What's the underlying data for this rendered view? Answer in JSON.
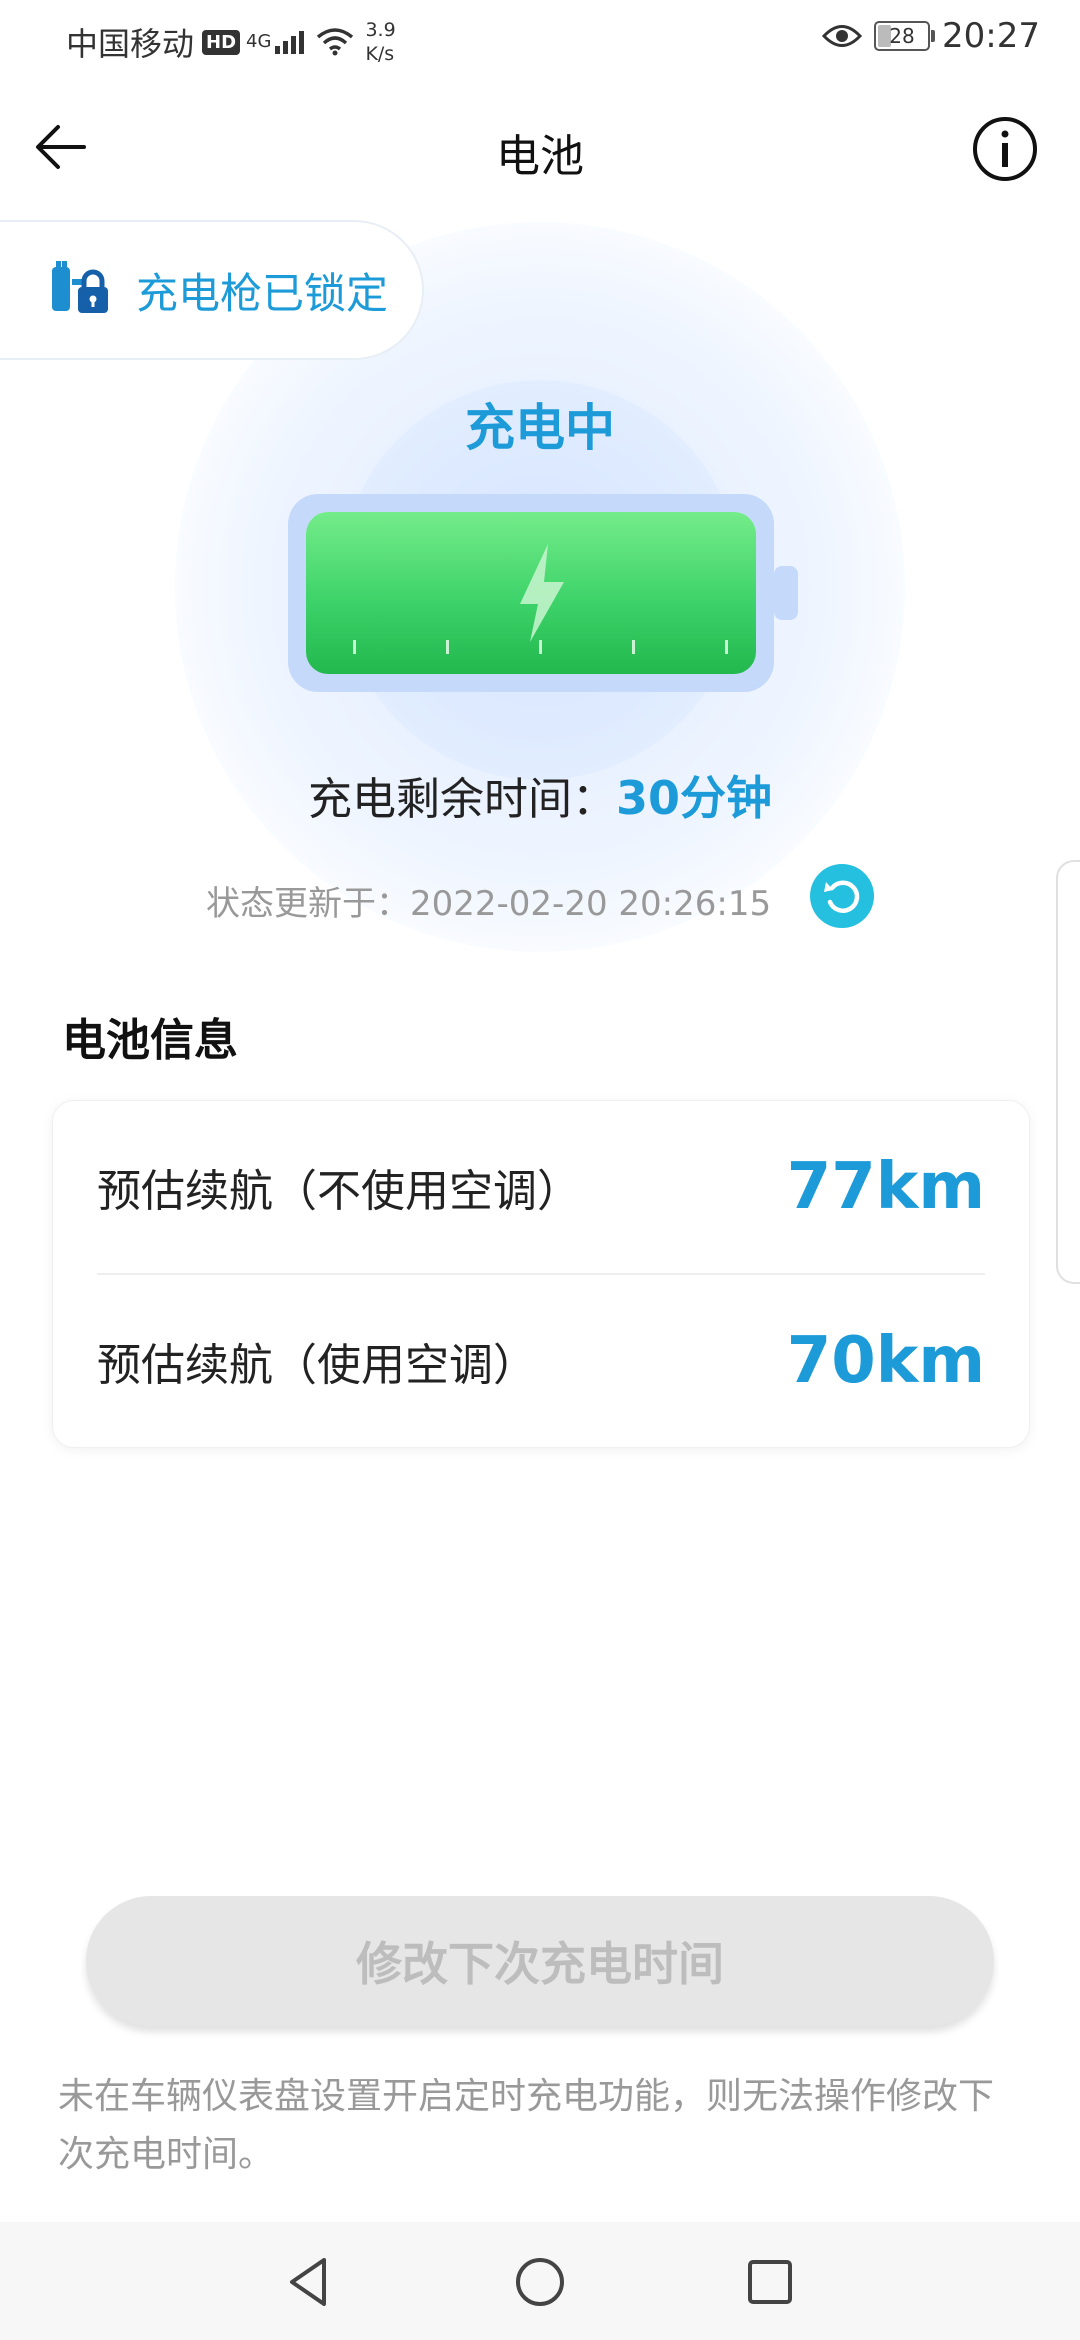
{
  "status_bar": {
    "carrier": "中国移动",
    "hd_badge": "HD",
    "network": "4G",
    "speed_value": "3.9",
    "speed_unit": "K/s",
    "battery_level": "28",
    "battery_fraction": 0.28,
    "time": "20:27"
  },
  "header": {
    "title": "电池",
    "back_icon": "arrow-left-icon",
    "info_icon": "info-icon"
  },
  "lock_status": {
    "icon": "charging-gun-lock-icon",
    "text": "充电枪已锁定"
  },
  "charging": {
    "state": "充电中",
    "remaining_label": "充电剩余时间：",
    "remaining_value": "30分钟",
    "updated_label": "状态更新于：",
    "updated_time": "2022-02-20 20:26:15",
    "refresh_icon": "refresh-icon",
    "battery_fill": 1.0
  },
  "battery_info": {
    "section_title": "电池信息",
    "rows": [
      {
        "label": "预估续航（不使用空调）",
        "value": "77km"
      },
      {
        "label": "预估续航（使用空调）",
        "value": "70km"
      }
    ]
  },
  "footer": {
    "button_label": "修改下次充电时间",
    "hint": "未在车辆仪表盘设置开启定时充电功能，则无法操作修改下次充电时间。"
  },
  "nav": {
    "back_icon": "triangle-back-icon",
    "home_icon": "circle-home-icon",
    "recent_icon": "square-recent-icon"
  },
  "colors": {
    "accent": "#1d9bd8",
    "battery_green": "#3ed36a",
    "refresh": "#25c0e0"
  }
}
